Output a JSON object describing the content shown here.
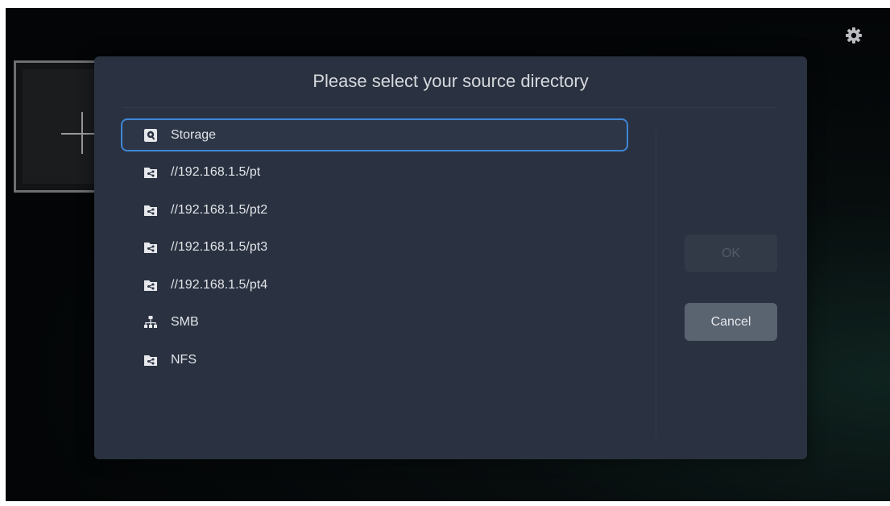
{
  "dialog": {
    "title": "Please select your source directory",
    "items": [
      {
        "label": "Storage",
        "icon": "storage-icon",
        "focused": true
      },
      {
        "label": "//192.168.1.5/pt",
        "icon": "network-share-folder-icon"
      },
      {
        "label": "//192.168.1.5/pt2",
        "icon": "network-share-folder-icon"
      },
      {
        "label": "//192.168.1.5/pt3",
        "icon": "network-share-folder-icon"
      },
      {
        "label": "//192.168.1.5/pt4",
        "icon": "network-share-folder-icon"
      },
      {
        "label": "SMB",
        "icon": "network-tree-icon"
      },
      {
        "label": "NFS",
        "icon": "network-share-folder-icon"
      }
    ],
    "ok_label": "OK",
    "ok_enabled": false,
    "cancel_label": "Cancel"
  },
  "colors": {
    "dialog_bg": "#2a3241",
    "focus_border": "#3f86d6",
    "cancel_bg": "#5a6370"
  }
}
